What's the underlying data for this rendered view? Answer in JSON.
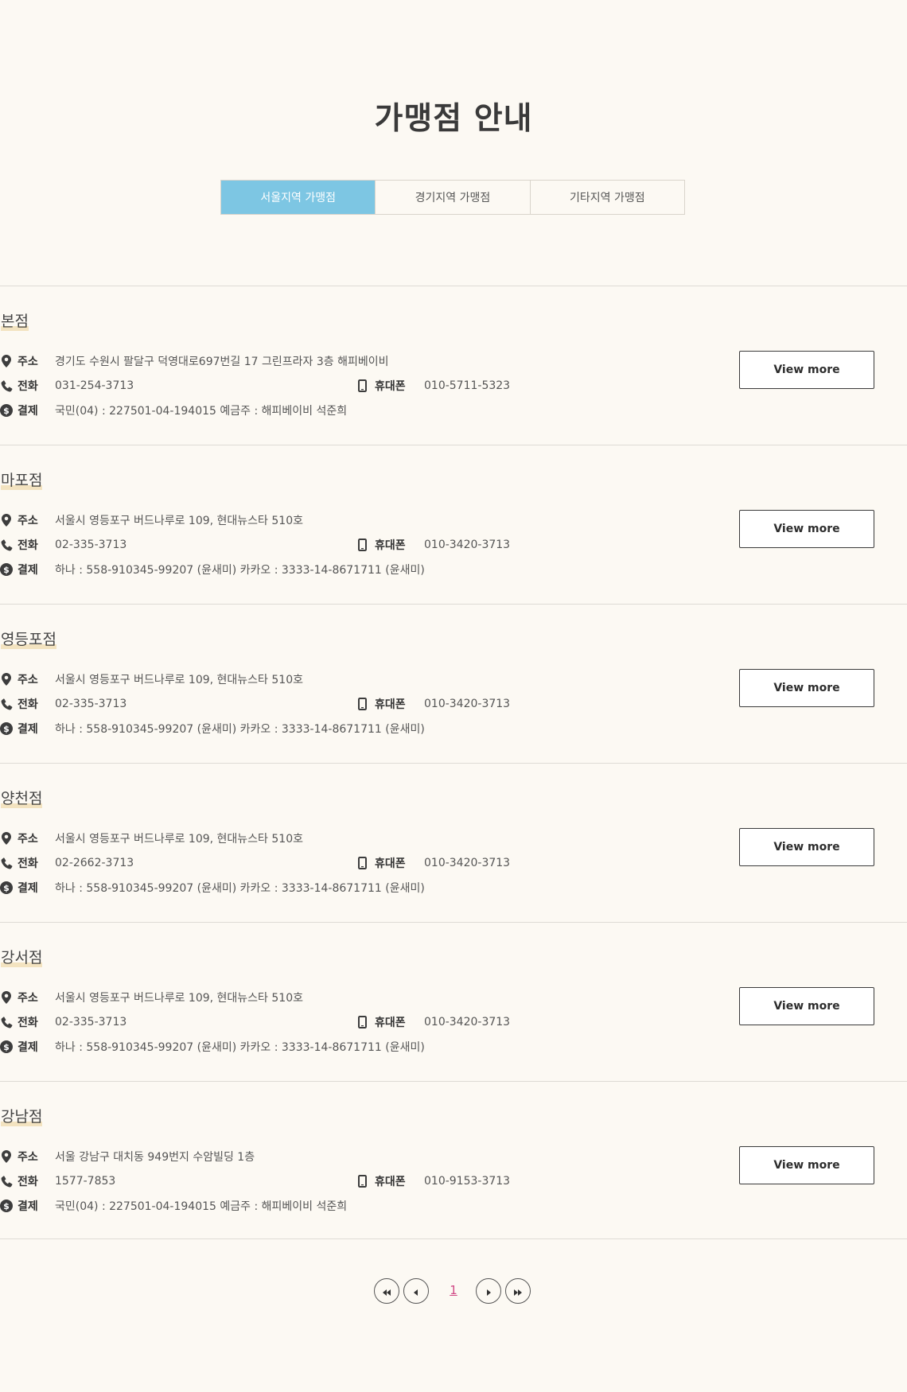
{
  "page": {
    "title": "가맹점 안내"
  },
  "tabs": [
    {
      "label": "서울지역 가맹점",
      "active": true
    },
    {
      "label": "경기지역 가맹점",
      "active": false
    },
    {
      "label": "기타지역 가맹점",
      "active": false
    }
  ],
  "labels": {
    "address": "주소",
    "phone": "전화",
    "payment": "결제",
    "mobile": "휴대폰",
    "view_more": "View more"
  },
  "icons": {
    "address": "map-pin-icon",
    "phone": "phone-icon",
    "payment": "dollar-coin-icon",
    "mobile": "mobile-phone-icon"
  },
  "stores": [
    {
      "name": "본점",
      "address": "경기도 수원시 팔달구 덕영대로697번길 17 그린프라자 3층 해피베이비",
      "phone": "031-254-3713",
      "mobile": "010-5711-5323",
      "payment": "국민(04) : 227501-04-194015 예금주 : 해피베이비 석준희"
    },
    {
      "name": "마포점",
      "address": "서울시 영등포구 버드나루로 109, 현대뉴스타 510호",
      "phone": "02-335-3713",
      "mobile": "010-3420-3713",
      "payment": "하나 : 558-910345-99207 (윤새미) 카카오 : 3333-14-8671711 (윤새미)"
    },
    {
      "name": "영등포점",
      "address": "서울시 영등포구 버드나루로 109, 현대뉴스타 510호",
      "phone": "02-335-3713",
      "mobile": "010-3420-3713",
      "payment": "하나 : 558-910345-99207 (윤새미) 카카오 : 3333-14-8671711 (윤새미)"
    },
    {
      "name": "양천점",
      "address": "서울시 영등포구 버드나루로 109, 현대뉴스타 510호",
      "phone": "02-2662-3713",
      "mobile": "010-3420-3713",
      "payment": "하나 : 558-910345-99207 (윤새미) 카카오 : 3333-14-8671711 (윤새미)"
    },
    {
      "name": "강서점",
      "address": "서울시 영등포구 버드나루로 109, 현대뉴스타 510호",
      "phone": "02-335-3713",
      "mobile": "010-3420-3713",
      "payment": "하나 : 558-910345-99207 (윤새미) 카카오 : 3333-14-8671711 (윤새미)"
    },
    {
      "name": "강남점",
      "address": "서울 강남구 대치동 949번지 수암빌딩 1층",
      "phone": "1577-7853",
      "mobile": "010-9153-3713",
      "payment": "국민(04) : 227501-04-194015 예금주 : 해피베이비 석준희"
    }
  ],
  "pagination": {
    "current_page": "1",
    "first_icon": "double-chevron-left-icon",
    "prev_icon": "chevron-left-icon",
    "next_icon": "chevron-right-icon",
    "last_icon": "double-chevron-right-icon"
  },
  "colors": {
    "background": "#fcf9f3",
    "active_tab": "#7dc6e3",
    "name_highlight": "#f3e3c0",
    "current_page": "#d04a86"
  }
}
